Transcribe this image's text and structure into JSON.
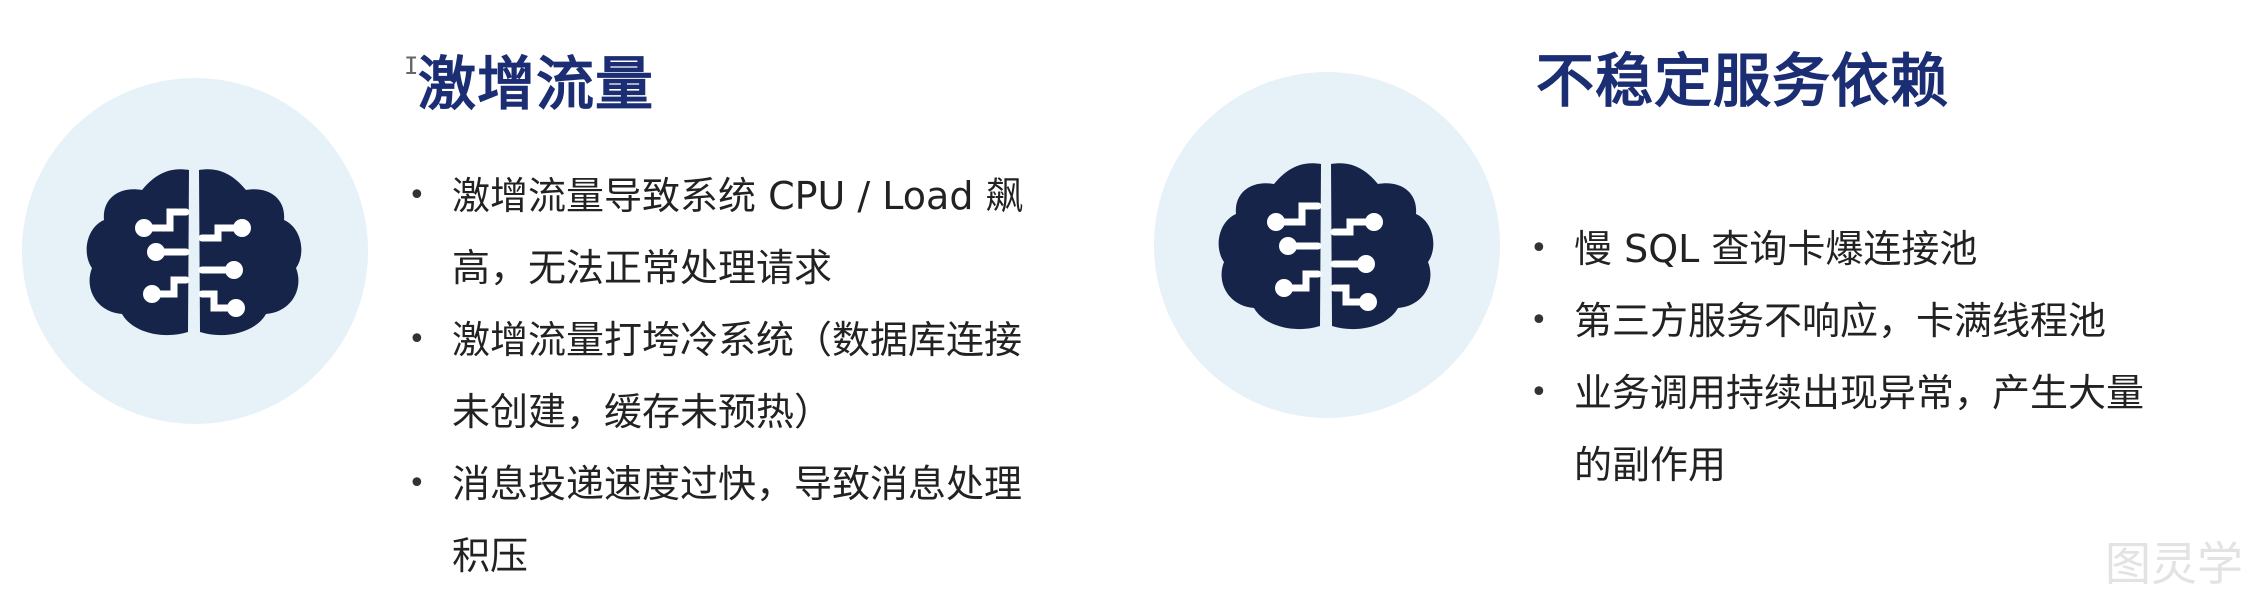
{
  "left": {
    "icon": "brain-circuit-icon",
    "title": "激增流量",
    "bullets": [
      {
        "line1": "激增流量导致系统 CPU / Load 飙",
        "line2": "高，无法正常处理请求"
      },
      {
        "line1": "激增流量打垮冷系统（数据库连接",
        "line2": "未创建，缓存未预热）"
      },
      {
        "line1": "消息投递速度过快，导致消息处理",
        "line2": "积压"
      }
    ]
  },
  "right": {
    "icon": "brain-circuit-icon",
    "title": "不稳定服务依赖",
    "bullets": [
      {
        "line1": "慢 SQL 查询卡爆连接池",
        "line2": ""
      },
      {
        "line1": "第三方服务不响应，卡满线程池",
        "line2": ""
      },
      {
        "line1": "业务调用持续出现异常，产生大量",
        "line2": "的副作用"
      }
    ]
  },
  "cursor_glyph": "I",
  "watermark": "图灵学",
  "colors": {
    "title": "#1b2d73",
    "icon": "#17244a",
    "circle": "#e6f1f8"
  }
}
